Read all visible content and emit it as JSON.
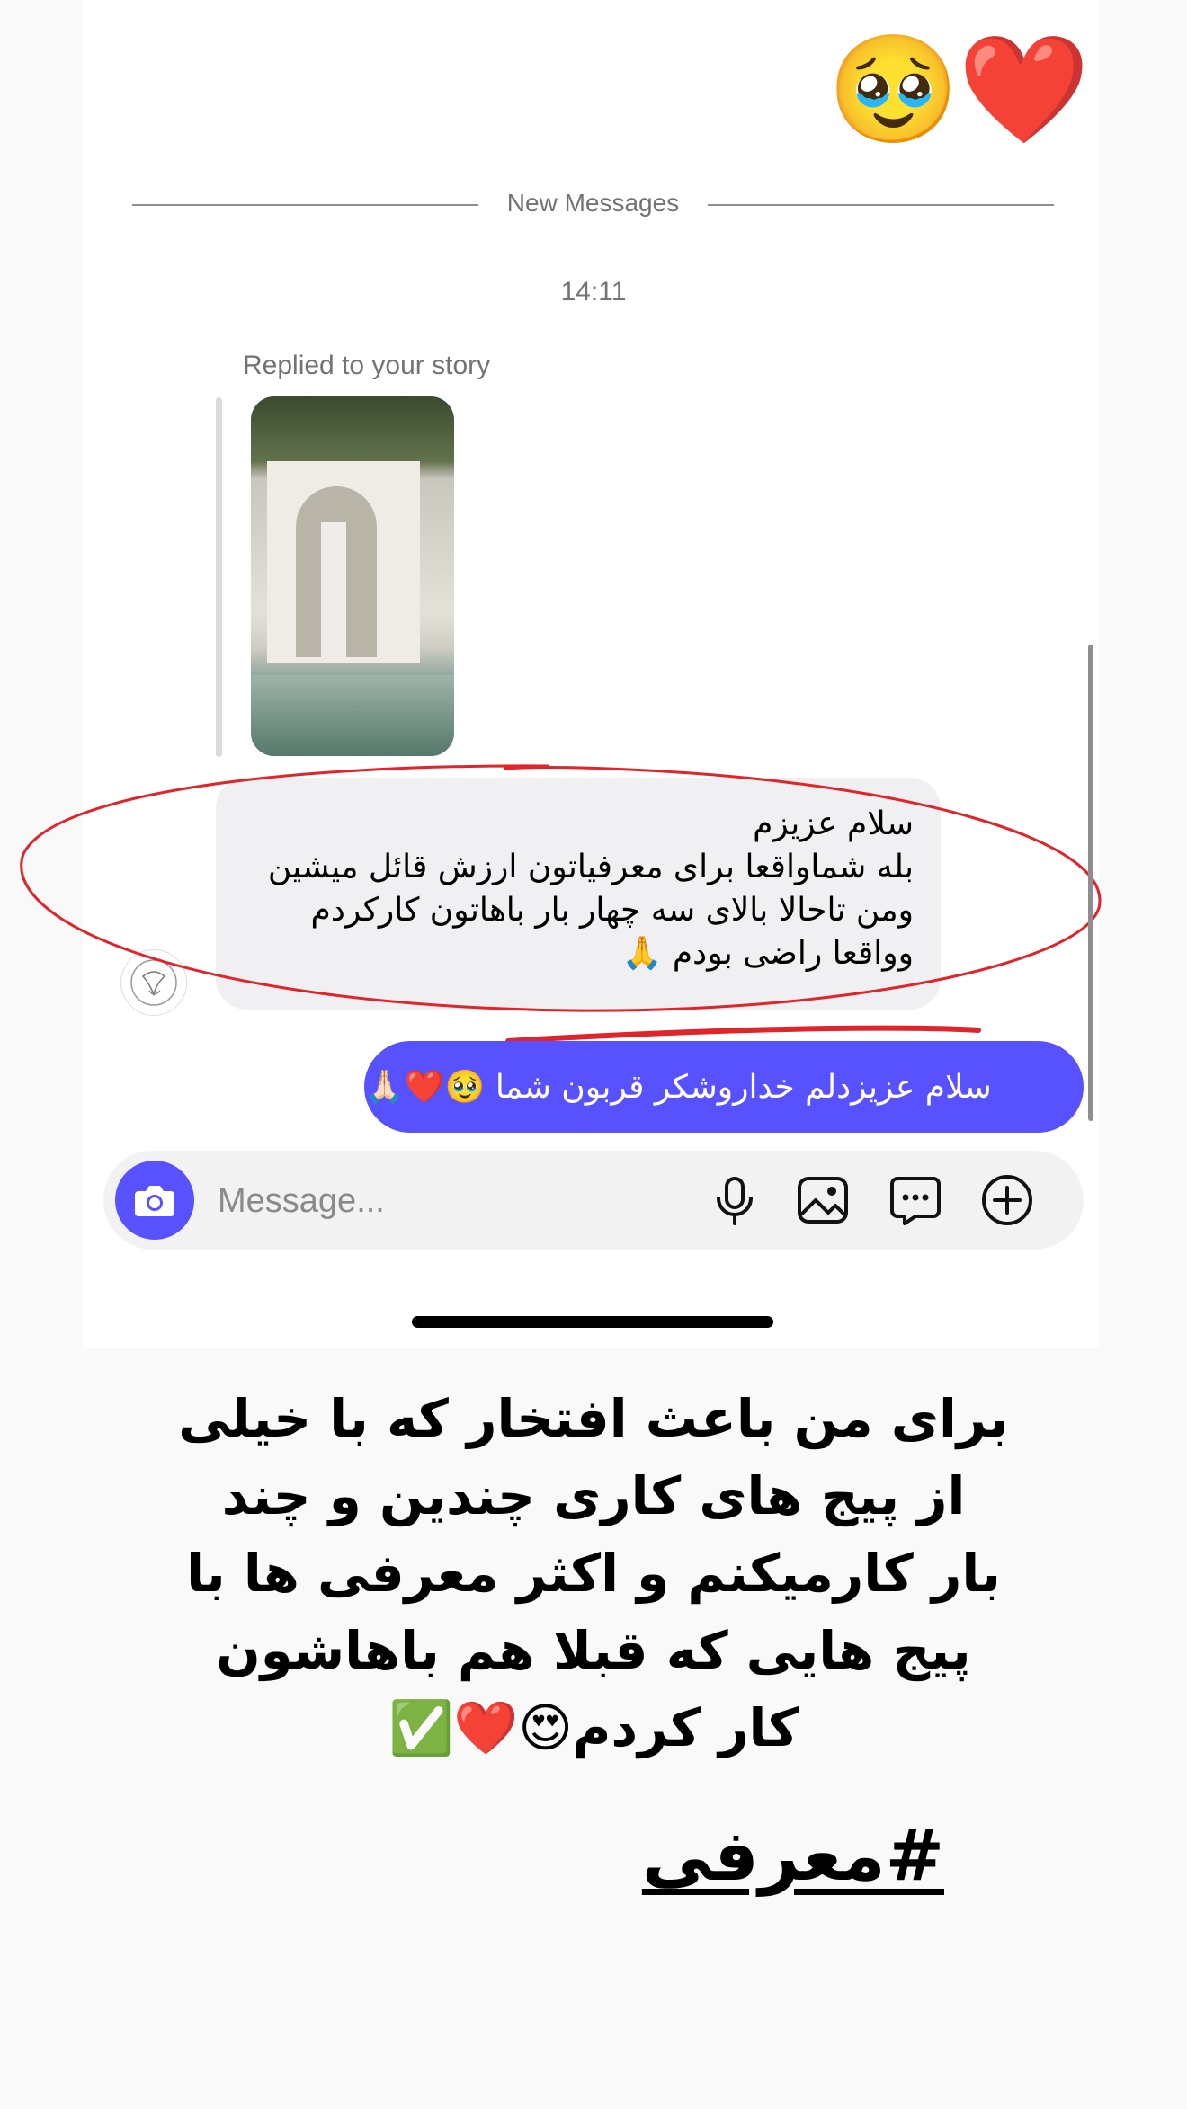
{
  "chat": {
    "top_emojis": [
      "🥹",
      "❤️"
    ],
    "divider_label": "New Messages",
    "timestamp": "14:11",
    "reply_label": "Replied to your story",
    "story_caption": "...",
    "incoming_message": {
      "lines": [
        "سلام عزیزم",
        "بله شماواقعا برای معرفیاتون ارزش قائل میشین",
        "ومن تاحالا بالای سه چهار بار باهاتون کارکردم",
        "وواقعا راضی بودم 🙏"
      ]
    },
    "outgoing_message": "سلام عزیزدلم خداروشکر قربون شما 🥹❤️🙏🏻"
  },
  "composer": {
    "placeholder": "Message...",
    "icons": [
      "camera-icon",
      "microphone-icon",
      "gallery-icon",
      "sticker-icon",
      "plus-icon"
    ],
    "accent_color": "#5851ff"
  },
  "annotation": {
    "color": "#e0242a"
  },
  "caption": {
    "lines": [
      "برای من باعث افتخار که با خیلی",
      "از پیج های کاری چندین و چند",
      "بار کارمیکنم و اکثر معرفی ها با",
      "پیج هایی که قبلا هم باهاشون",
      "کار کردم😍❤️✅"
    ],
    "hashtag": "#معرفی"
  }
}
